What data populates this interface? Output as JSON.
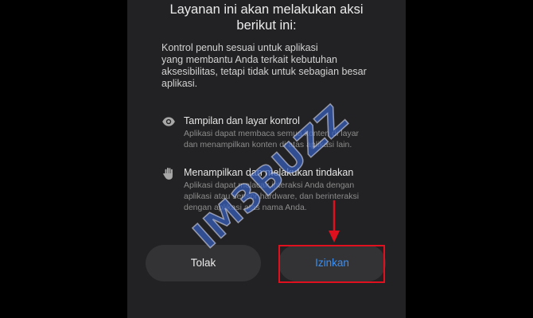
{
  "dialog": {
    "title_lines": [
      "Layanan ini akan melakukan aksi",
      "berikut ini:"
    ],
    "description_lines": [
      "Kontrol penuh sesuai untuk aplikasi",
      "yang membantu Anda terkait kebutuhan",
      "aksesibilitas, tetapi tidak untuk sebagian besar",
      "aplikasi."
    ],
    "permissions": [
      {
        "icon": "eye-icon",
        "title": "Tampilan dan layar kontrol",
        "description_lines": [
          "Aplikasi dapat membaca semua konten di layar",
          "dan menampilkan konten di atas aplikasi lain."
        ]
      },
      {
        "icon": "hand-icon",
        "title": "Menampilkan dan melakukan tindakan",
        "description_lines": [
          "Aplikasi dapat melacak interaksi Anda dengan",
          "aplikasi atau sensor hardware, dan berinteraksi",
          "dengan aplikasi atas nama Anda."
        ]
      }
    ],
    "buttons": {
      "deny": "Tolak",
      "allow": "Izinkan"
    }
  },
  "watermark": {
    "text": "IM3BUZZ"
  },
  "colors": {
    "background": "#000000",
    "dialog_background": "#222224",
    "button_background": "#333336",
    "allow_text": "#3d8ff0",
    "highlight": "#e0101e",
    "watermark": "#375fbe"
  }
}
